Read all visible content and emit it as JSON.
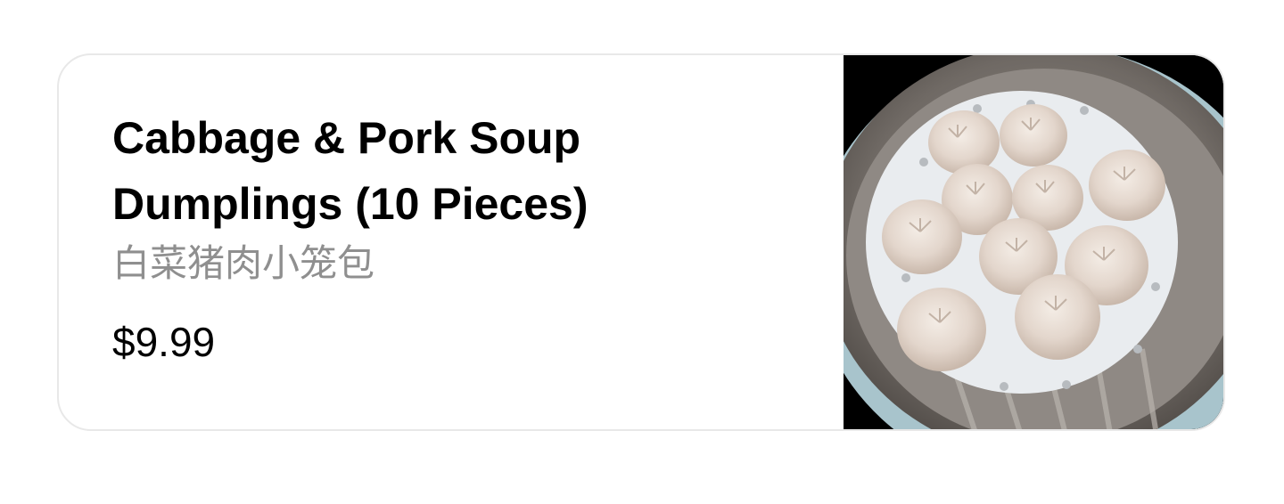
{
  "menu_item": {
    "name": "Cabbage & Pork Soup Dumplings (10 Pieces)",
    "name_zh": "白菜猪肉小笼包",
    "price": "$9.99"
  },
  "photo": {
    "icon": "soup-dumplings-photo"
  }
}
